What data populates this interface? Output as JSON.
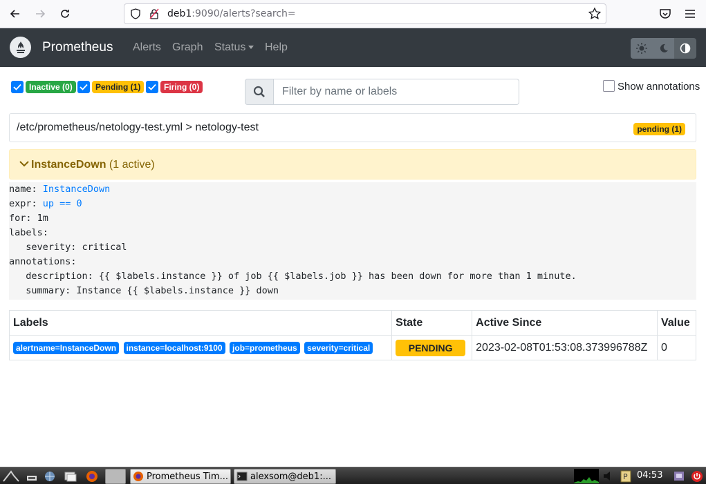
{
  "browser": {
    "url_host": "deb1",
    "url_rest": ":9090/alerts?search=",
    "icons": [
      "back-icon",
      "forward-icon",
      "reload-icon",
      "shield-icon",
      "lock-icon",
      "star-icon",
      "pocket-icon",
      "menu-icon"
    ]
  },
  "navbar": {
    "brand": "Prometheus",
    "links": [
      "Alerts",
      "Graph",
      "Status",
      "Help"
    ]
  },
  "filters": {
    "inactive": "Inactive (0)",
    "pending": "Pending (1)",
    "firing": "Firing (0)",
    "search_placeholder": "Filter by name or labels",
    "show_annotations": "Show annotations"
  },
  "group": {
    "path": "/etc/prometheus/netology-test.yml > netology-test",
    "badge": "pending (1)"
  },
  "alert": {
    "name": "InstanceDown",
    "active": "(1 active)",
    "rule": {
      "name_key": "name: ",
      "name_val": "InstanceDown",
      "expr_key": "expr: ",
      "expr_val": "up == 0",
      "for": "for: 1m",
      "labels": "labels:",
      "severity": "  severity: critical",
      "annotations": "annotations:",
      "description": "  description: {{ $labels.instance }} of job {{ $labels.job }} has been down for more than 1 minute.",
      "summary": "  summary: Instance {{ $labels.instance }} down"
    }
  },
  "table": {
    "headers": [
      "Labels",
      "State",
      "Active Since",
      "Value"
    ],
    "row": {
      "labels": [
        "alertname=InstanceDown",
        "instance=localhost:9100",
        "job=prometheus",
        "severity=critical"
      ],
      "state": "PENDING",
      "active_since": "2023-02-08T01:53:08.373996788Z",
      "value": "0"
    }
  },
  "taskbar": {
    "tasks": [
      "Prometheus Tim...",
      "alexsom@deb1:..."
    ],
    "clock": "04:53"
  },
  "colors": {
    "navbar": "#343a40",
    "primary": "#007bff",
    "success": "#28a745",
    "warning": "#ffc107",
    "danger": "#dc3545"
  }
}
